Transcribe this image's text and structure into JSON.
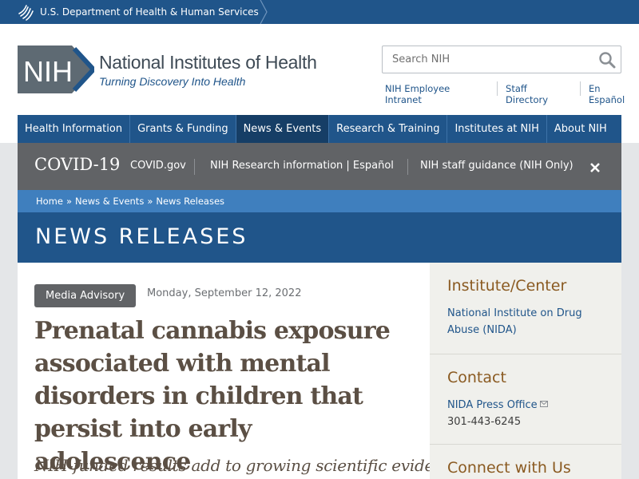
{
  "hhs_bar": {
    "label": "U.S. Department of Health & Human Services"
  },
  "header": {
    "logo_abbrev": "NIH",
    "org_name": "National Institutes of Health",
    "tagline": "Turning Discovery Into Health",
    "search": {
      "placeholder": "Search NIH",
      "value": ""
    },
    "util_links": [
      "NIH Employee Intranet",
      "Staff Directory",
      "En Español"
    ]
  },
  "main_nav": {
    "items": [
      "Health Information",
      "Grants & Funding",
      "News & Events",
      "Research & Training",
      "Institutes at NIH",
      "About NIH"
    ],
    "active": "News & Events"
  },
  "covid_bar": {
    "title": "COVID-19",
    "links": [
      "COVID.gov",
      "NIH Research information | Español",
      "NIH staff guidance (NIH Only)"
    ]
  },
  "breadcrumb": {
    "items": [
      "Home",
      "News & Events",
      "News Releases"
    ],
    "separator": "»"
  },
  "banner": {
    "title": "NEWS RELEASES"
  },
  "article": {
    "tag": "Media Advisory",
    "date": "Monday, September 12, 2022",
    "headline": "Prenatal cannabis exposure associated with mental disorders in children that persist into early adolescence",
    "subhead": "NIH-funded results add to growing scientific evidence"
  },
  "sidebar": {
    "institute": {
      "heading": "Institute/Center",
      "link": "National Institute on Drug Abuse (NIDA)"
    },
    "contact": {
      "heading": "Contact",
      "link": "NIDA Press Office",
      "phone": "301-443-6245"
    },
    "connect": {
      "heading": "Connect with Us"
    }
  },
  "colors": {
    "nih_blue": "#20558a",
    "breadcrumb_blue": "#3f7fbe",
    "covid_grey": "#616366",
    "heading_brown": "#8a5a21",
    "headline_brown": "#5b4f44",
    "page_grey": "#e4e6e8",
    "sidebar_bg": "#f0f0ec"
  }
}
